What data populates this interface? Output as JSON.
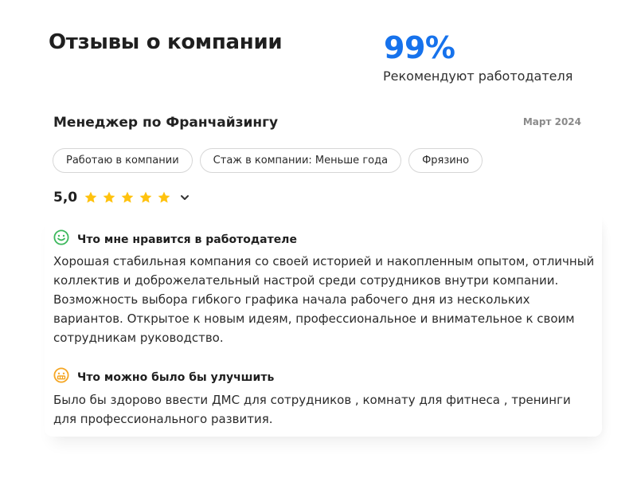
{
  "header": {
    "title": "Отзывы о компании",
    "recommend_percent": "99%",
    "recommend_label": "Рекомендуют работодателя"
  },
  "review": {
    "position": "Менеджер по Франчайзингу",
    "date": "Март 2024",
    "tags": [
      "Работаю в компании",
      "Стаж в компании: Меньше года",
      "Фрязино"
    ],
    "rating": "5,0",
    "stars": 5,
    "pros_title": "Что мне нравится в работодателе",
    "pros_text": "Хорошая стабильная компания со своей историей и накопленным опытом, отличный коллектив и доброжелательный настрой среди сотрудников внутри компании. Возможность выбора гибкого графика начала рабочего дня из нескольких вариантов. Открытое к новым идеям, профессиональное и внимательное к своим сотрудникам руководство.",
    "cons_title": "Что можно было бы улучшить",
    "cons_text": "Было бы здорово ввести ДМС для сотрудников , комнату для фитнеса , тренинги для профессионального развития."
  },
  "colors": {
    "accent": "#1672ec",
    "star": "#ffc20e",
    "pros_icon": "#3cb85c",
    "cons_icon": "#f5a623"
  },
  "icons": {
    "pros": "smile-icon",
    "cons": "grimace-icon",
    "star": "star-icon",
    "expand": "chevron-down-icon"
  }
}
